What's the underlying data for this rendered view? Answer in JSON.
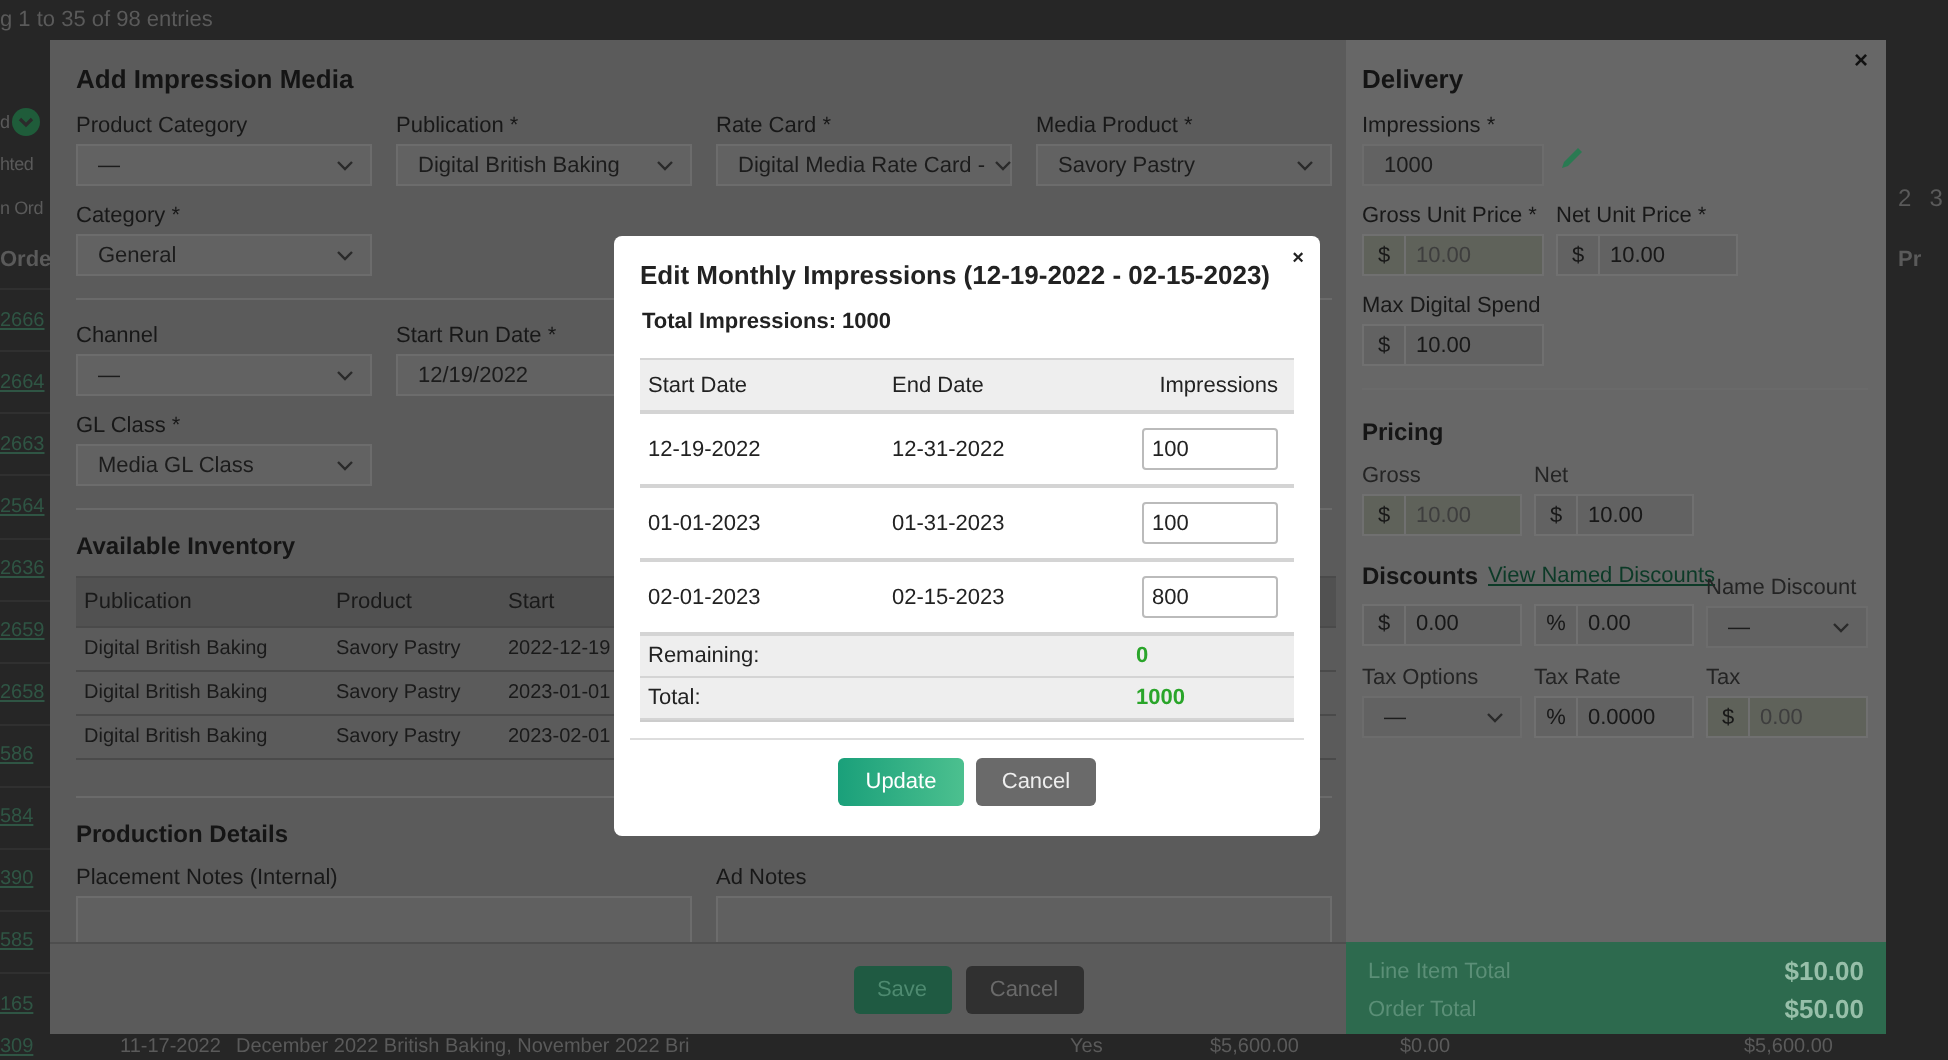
{
  "page": {
    "entries_info": "g 1 to 35 of 98 entries",
    "left_fragments": [
      "d",
      "hted",
      "n Ord"
    ],
    "order_column": "Orde",
    "order_links": [
      "2666",
      "2664",
      "2663",
      "2564",
      "2636",
      "2659",
      "2658",
      "586",
      "584",
      "390",
      "585",
      "165"
    ],
    "pagination": [
      "2",
      "3"
    ],
    "right_column": "Pr",
    "bottom_row": [
      "309",
      "11-17-2022",
      "December 2022 British Baking, November 2022 Bri",
      "Yes",
      "$5,600.00",
      "$0.00",
      "$5,600.00"
    ]
  },
  "add_media_dialog": {
    "title": "Add Impression Media",
    "close": "×",
    "product_fields": [
      {
        "kind": "select",
        "label": "Product Category",
        "value": "—"
      },
      {
        "kind": "select",
        "label": "Publication *",
        "value": "Digital British Baking"
      },
      {
        "kind": "select",
        "label": "Rate Card *",
        "value": "Digital Media Rate Card -"
      },
      {
        "kind": "select",
        "label": "Media Product *",
        "value": "Savory Pastry"
      }
    ],
    "category": {
      "kind": "select",
      "label": "Category *",
      "value": "General"
    },
    "run_fields": [
      {
        "kind": "select",
        "label": "Channel",
        "value": "—"
      },
      {
        "kind": "input",
        "label": "Start Run Date *",
        "value": "12/19/2022"
      }
    ],
    "gl_class": {
      "kind": "select",
      "label": "GL Class *",
      "value": "Media GL Class"
    },
    "inventory": {
      "heading": "Available Inventory",
      "columns": [
        "Publication",
        "Product",
        "Start"
      ],
      "rows": [
        [
          "Digital British Baking",
          "Savory Pastry",
          "2022-12-19"
        ],
        [
          "Digital British Baking",
          "Savory Pastry",
          "2023-01-01"
        ],
        [
          "Digital British Baking",
          "Savory Pastry",
          "2023-02-01"
        ]
      ]
    },
    "production": {
      "heading": "Production Details",
      "fields": [
        {
          "label": "Placement Notes (Internal)"
        },
        {
          "label": "Ad Notes"
        }
      ]
    },
    "buttons": [
      {
        "label": "Save",
        "kind": "primary"
      },
      {
        "label": "Cancel",
        "kind": "secondary"
      }
    ],
    "delivery": {
      "heading": "Delivery",
      "impressions": {
        "kind": "input",
        "label": "Impressions *",
        "value": "1000"
      },
      "unit_prices": [
        {
          "kind": "addon",
          "label": "Gross Unit Price *",
          "prefix": "$",
          "value": "10.00",
          "disabled": true
        },
        {
          "kind": "addon",
          "label": "Net Unit Price *",
          "prefix": "$",
          "value": "10.00",
          "disabled": false
        }
      ],
      "max_spend": {
        "kind": "addon",
        "label": "Max Digital Spend",
        "prefix": "$",
        "value": "10.00",
        "disabled": false
      }
    },
    "pricing": {
      "heading": "Pricing",
      "fields": [
        {
          "kind": "addon",
          "label": "Gross",
          "prefix": "$",
          "value": "10.00",
          "disabled": true
        },
        {
          "kind": "addon",
          "label": "Net",
          "prefix": "$",
          "value": "10.00",
          "disabled": false
        }
      ]
    },
    "discounts": {
      "heading": "Discounts",
      "link": "View Named Discounts",
      "fields": [
        {
          "kind": "addon",
          "prefix": "$",
          "value": "0.00",
          "disabled": false
        },
        {
          "kind": "addon",
          "prefix": "%",
          "value": "0.00",
          "disabled": false
        },
        {
          "kind": "select",
          "label": "Name Discount",
          "value": "—"
        }
      ]
    },
    "tax": [
      {
        "kind": "select",
        "label": "Tax Options",
        "value": "—"
      },
      {
        "kind": "addon",
        "label": "Tax Rate",
        "prefix": "%",
        "value": "0.0000",
        "disabled": false
      },
      {
        "kind": "addon",
        "label": "Tax",
        "prefix": "$",
        "value": "0.00",
        "disabled": true
      }
    ],
    "totals": [
      {
        "label": "Line Item Total",
        "value": "$10.00"
      },
      {
        "label": "Order Total",
        "value": "$50.00"
      }
    ]
  },
  "impressions_dialog": {
    "title": "Edit Monthly Impressions (12-19-2022 - 02-15-2023)",
    "close": "×",
    "total": "Total Impressions: 1000",
    "columns": [
      "Start Date",
      "End Date",
      "Impressions"
    ],
    "rows": [
      {
        "start": "12-19-2022",
        "end": "12-31-2022",
        "impressions": "100"
      },
      {
        "start": "01-01-2023",
        "end": "01-31-2023",
        "impressions": "100"
      },
      {
        "start": "02-01-2023",
        "end": "02-15-2023",
        "impressions": "800"
      }
    ],
    "summary": [
      {
        "label": "Remaining:",
        "value": "0"
      },
      {
        "label": "Total:",
        "value": "1000"
      }
    ],
    "buttons": [
      {
        "label": "Update",
        "kind": "primary"
      },
      {
        "label": "Cancel",
        "kind": "secondary"
      }
    ]
  }
}
